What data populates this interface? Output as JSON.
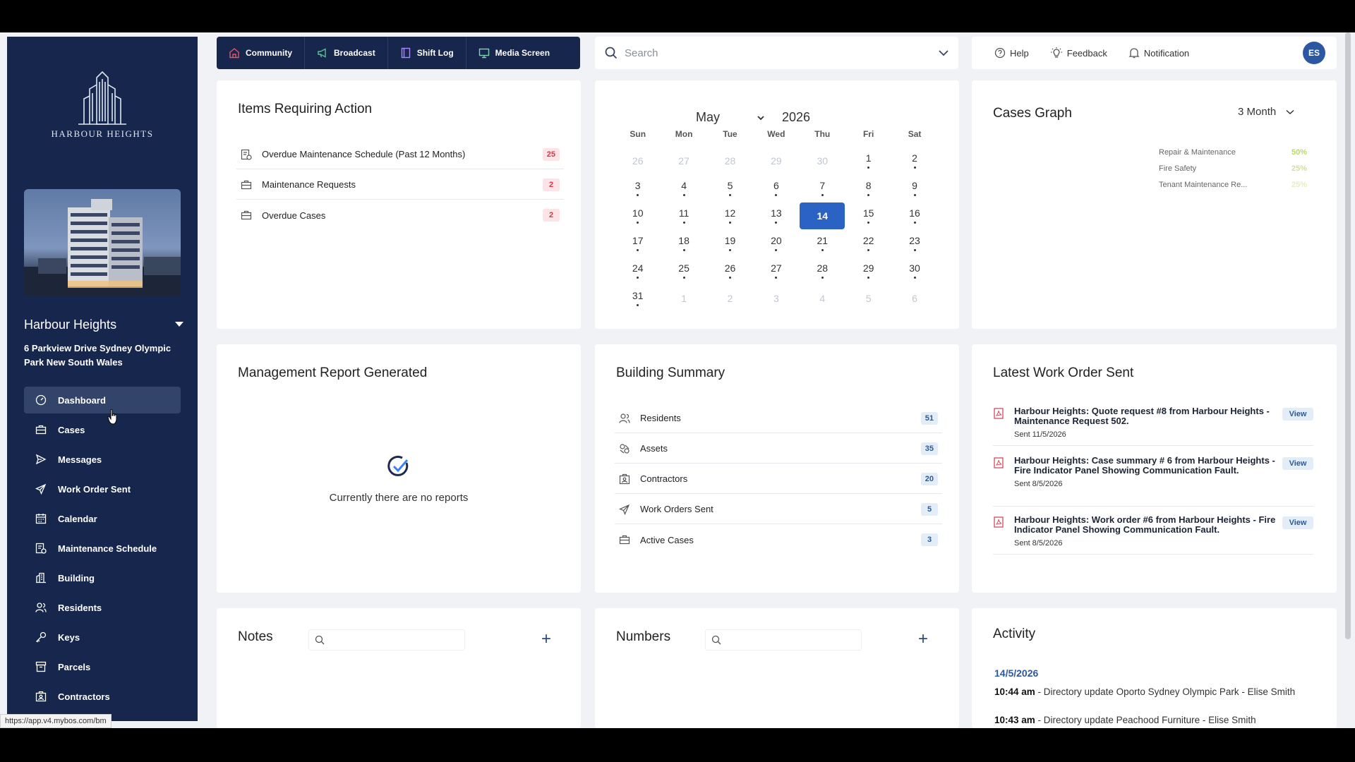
{
  "sidebar": {
    "logo_text": "HARBOUR HEIGHTS",
    "building_name": "Harbour Heights",
    "address": "6 Parkview Drive Sydney Olympic Park New South Wales",
    "nav": [
      {
        "label": "Dashboard",
        "icon": "dashboard-icon",
        "active": true
      },
      {
        "label": "Cases",
        "icon": "briefcase-icon"
      },
      {
        "label": "Messages",
        "icon": "send-icon"
      },
      {
        "label": "Work Order Sent",
        "icon": "paper-plane-icon"
      },
      {
        "label": "Calendar",
        "icon": "calendar-icon"
      },
      {
        "label": "Maintenance Schedule",
        "icon": "schedule-icon"
      },
      {
        "label": "Building",
        "icon": "building-icon"
      },
      {
        "label": "Residents",
        "icon": "users-icon"
      },
      {
        "label": "Keys",
        "icon": "key-icon"
      },
      {
        "label": "Parcels",
        "icon": "parcel-icon"
      },
      {
        "label": "Contractors",
        "icon": "contractor-icon"
      }
    ]
  },
  "status_url": "https://app.v4.mybos.com/bm",
  "topnav": [
    {
      "label": "Community",
      "icon": "community-icon"
    },
    {
      "label": "Broadcast",
      "icon": "megaphone-icon"
    },
    {
      "label": "Shift Log",
      "icon": "book-icon"
    },
    {
      "label": "Media Screen",
      "icon": "monitor-icon"
    }
  ],
  "search": {
    "placeholder": "Search"
  },
  "topright": {
    "help": "Help",
    "feedback": "Feedback",
    "notification": "Notification",
    "avatar_initials": "ES"
  },
  "items_requiring_action": {
    "title": "Items Requiring Action",
    "rows": [
      {
        "label": "Overdue Maintenance Schedule (Past 12 Months)",
        "count": "25"
      },
      {
        "label": "Maintenance Requests",
        "count": "2"
      },
      {
        "label": "Overdue Cases",
        "count": "2"
      }
    ]
  },
  "calendar": {
    "month": "May",
    "year": "2026",
    "days_of_week": [
      "Sun",
      "Mon",
      "Tue",
      "Wed",
      "Thu",
      "Fri",
      "Sat"
    ],
    "weeks": [
      [
        [
          "26",
          0,
          0
        ],
        [
          "27",
          0,
          0
        ],
        [
          "28",
          0,
          0
        ],
        [
          "29",
          0,
          0
        ],
        [
          "30",
          0,
          0
        ],
        [
          "1",
          1,
          1
        ],
        [
          "2",
          1,
          1
        ]
      ],
      [
        [
          "3",
          1,
          1
        ],
        [
          "4",
          1,
          1
        ],
        [
          "5",
          1,
          1
        ],
        [
          "6",
          1,
          1
        ],
        [
          "7",
          1,
          1
        ],
        [
          "8",
          1,
          1
        ],
        [
          "9",
          1,
          1
        ]
      ],
      [
        [
          "10",
          1,
          1
        ],
        [
          "11",
          1,
          1
        ],
        [
          "12",
          1,
          1
        ],
        [
          "13",
          1,
          1
        ],
        [
          "14",
          1,
          0
        ],
        [
          "15",
          1,
          1
        ],
        [
          "16",
          1,
          1
        ]
      ],
      [
        [
          "17",
          1,
          1
        ],
        [
          "18",
          1,
          1
        ],
        [
          "19",
          1,
          1
        ],
        [
          "20",
          1,
          1
        ],
        [
          "21",
          1,
          1
        ],
        [
          "22",
          1,
          1
        ],
        [
          "23",
          1,
          1
        ]
      ],
      [
        [
          "24",
          1,
          1
        ],
        [
          "25",
          1,
          1
        ],
        [
          "26",
          1,
          1
        ],
        [
          "27",
          1,
          1
        ],
        [
          "28",
          1,
          1
        ],
        [
          "29",
          1,
          1
        ],
        [
          "30",
          1,
          1
        ]
      ],
      [
        [
          "31",
          1,
          1
        ],
        [
          "1",
          0,
          0
        ],
        [
          "2",
          0,
          0
        ],
        [
          "3",
          0,
          0
        ],
        [
          "4",
          0,
          0
        ],
        [
          "5",
          0,
          0
        ],
        [
          "6",
          0,
          0
        ]
      ]
    ],
    "today": "14"
  },
  "cases_graph": {
    "title": "Cases Graph",
    "range": "3 Month",
    "legend": [
      {
        "label": "Repair & Maintenance",
        "pct": "50%",
        "color": "#b9d96a"
      },
      {
        "label": "Fire Safety",
        "pct": "25%",
        "color": "#cfe29a"
      },
      {
        "label": "Tenant Maintenance Re...",
        "pct": "25%",
        "color": "#e2eec2"
      }
    ]
  },
  "management_report": {
    "title": "Management Report Generated",
    "empty_text": "Currently there are no reports"
  },
  "building_summary": {
    "title": "Building Summary",
    "rows": [
      {
        "label": "Residents",
        "count": "51",
        "icon": "users-icon"
      },
      {
        "label": "Assets",
        "count": "35",
        "icon": "assets-icon"
      },
      {
        "label": "Contractors",
        "count": "20",
        "icon": "contractor-icon"
      },
      {
        "label": "Work Orders Sent",
        "count": "5",
        "icon": "paper-plane-icon"
      },
      {
        "label": "Active Cases",
        "count": "3",
        "icon": "briefcase-icon"
      }
    ]
  },
  "work_orders": {
    "title": "Latest Work Order Sent",
    "view_label": "View",
    "items": [
      {
        "title": "Harbour Heights: Quote request #8 from Harbour Heights - Maintenance Request 502.",
        "sent": "Sent 11/5/2026"
      },
      {
        "title": "Harbour Heights: Case summary # 6 from Harbour Heights - Fire Indicator Panel Showing Communication Fault.",
        "sent": "Sent 8/5/2026"
      },
      {
        "title": "Harbour Heights: Work order #6 from Harbour Heights - Fire Indicator Panel Showing Communication Fault.",
        "sent": "Sent 8/5/2026"
      }
    ]
  },
  "notes": {
    "title": "Notes",
    "placeholder": ""
  },
  "numbers": {
    "title": "Numbers",
    "placeholder": ""
  },
  "activity": {
    "title": "Activity",
    "date": "14/5/2026",
    "items": [
      {
        "time": "10:44 am",
        "text": " - Directory update Oporto Sydney Olympic Park - Elise Smith"
      },
      {
        "time": "10:43 am",
        "text": " - Directory update Peachood Furniture - Elise Smith"
      }
    ]
  }
}
